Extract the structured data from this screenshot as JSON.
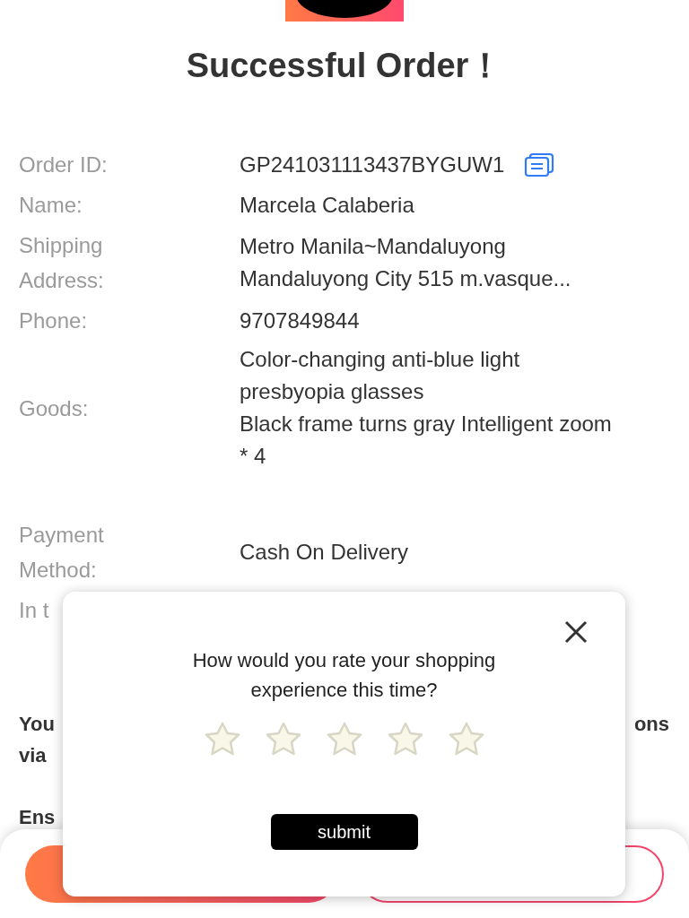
{
  "header": {
    "title": "Successful Order！"
  },
  "details": [
    {
      "kind": "copyable",
      "label": [
        "Order ID:"
      ],
      "values": [
        "GP241031113437BYGUW1"
      ]
    },
    {
      "kind": "plain",
      "label": [
        "Name:"
      ],
      "values": [
        "Marcela Calaberia"
      ]
    },
    {
      "kind": "plain",
      "label": [
        "Shipping",
        "Address:"
      ],
      "values": [
        "Metro Manila~Mandaluyong",
        "Mandaluyong City 515 m.vasque..."
      ]
    },
    {
      "kind": "plain",
      "label": [
        "Phone:"
      ],
      "values": [
        "9707849844"
      ]
    },
    {
      "kind": "plain",
      "label": [
        "Goods:"
      ],
      "values": [
        "Color-changing anti-blue light presbyopia glasses",
        "Black frame turns gray Intelligent zoom * 4"
      ]
    },
    {
      "kind": "spaced",
      "label": [
        "Payment",
        "Method:"
      ],
      "values": [
        "Cash On Delivery"
      ]
    },
    {
      "kind": "plain",
      "label": [
        "In t"
      ]
    }
  ],
  "notes": [
    {
      "left": "You",
      "right": "ons"
    },
    {
      "left": "via"
    },
    {
      "left": "Ens"
    }
  ],
  "rating_dialog": {
    "question": "How would you rate your shopping experience this time?",
    "stars": 0,
    "submit": "submit"
  }
}
